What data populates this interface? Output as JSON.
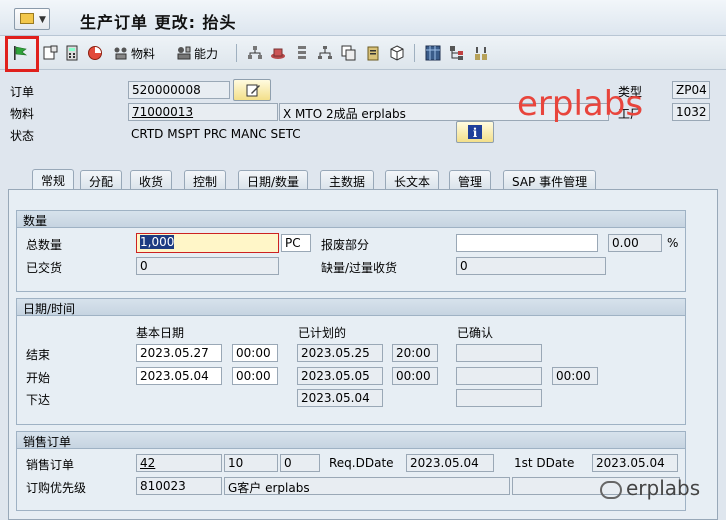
{
  "title": "生产订单 更改: 抬头",
  "toolbar": {
    "material_label": "物料",
    "capacity_label": "能力"
  },
  "header": {
    "order_label": "订单",
    "order_value": "520000008",
    "type_label": "类型",
    "type_value": "ZP04",
    "material_label": "物料",
    "material_value": "71000013",
    "material_desc": "X MTO 2成品 erplabs",
    "plant_label": "工厂",
    "plant_value": "1032",
    "status_label": "状态",
    "status_value": "CRTD MSPT PRC  MANC SETC"
  },
  "watermark_top": "erplabs",
  "tabs": [
    "常规",
    "分配",
    "收货",
    "控制",
    "日期/数量",
    "主数据",
    "长文本",
    "管理",
    "SAP 事件管理"
  ],
  "quantities": {
    "title": "数量",
    "total_label": "总数量",
    "total_value": "1,000",
    "unit": "PC",
    "scrap_label": "报废部分",
    "scrap_value": "",
    "scrap_pct": "0.00",
    "pct_sign": "%",
    "delivered_label": "已交货",
    "delivered_value": "0",
    "short_label": "缺量/过量收货",
    "short_value": "0"
  },
  "dates": {
    "title": "日期/时间",
    "col_basic": "基本日期",
    "col_planned": "已计划的",
    "col_confirmed": "已确认",
    "end_label": "结束",
    "end_basic_date": "2023.05.27",
    "end_basic_time": "00:00",
    "end_planned_date": "2023.05.25",
    "end_planned_time": "20:00",
    "start_label": "开始",
    "start_basic_date": "2023.05.04",
    "start_basic_time": "00:00",
    "start_planned_date": "2023.05.05",
    "start_planned_time": "00:00",
    "start_confirmed_time": "00:00",
    "release_label": "下达",
    "release_planned_date": "2023.05.04"
  },
  "sales": {
    "title": "销售订单",
    "so_label": "销售订单",
    "so_value": "42",
    "so_item": "10",
    "so_sched": "0",
    "req_label": "Req.DDate",
    "req_value": "2023.05.04",
    "first_label": "1st DDate",
    "first_value": "2023.05.04",
    "prio_label": "订购优先级",
    "prio_value": "810023",
    "customer": "G客户 erplabs"
  },
  "watermark_bottom": "erplabs"
}
